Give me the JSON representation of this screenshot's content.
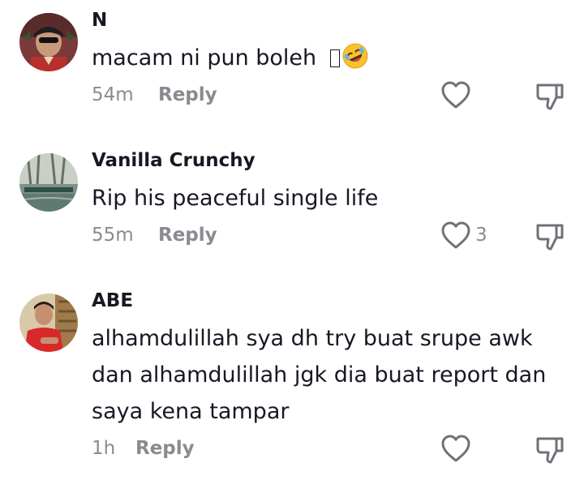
{
  "comments": [
    {
      "username": "N",
      "text": "macam ni pun boleh ",
      "emoji": "rolling-on-floor-laughing",
      "time": "54m",
      "reply_label": "Reply",
      "like_count": ""
    },
    {
      "username": "Vanilla Crunchy",
      "text": "Rip his peaceful single life",
      "time": "55m",
      "reply_label": "Reply",
      "like_count": "3"
    },
    {
      "username": "ABE",
      "text": "alhamdulillah sya dh try buat srupe awk dan alhamdulillah jgk dia buat report dan saya kena tampar",
      "time": "1h",
      "reply_label": "Reply",
      "like_count": ""
    }
  ],
  "icons": {
    "like": "heart-outline-icon",
    "dislike": "thumbs-down-outline-icon"
  },
  "colors": {
    "text": "#161823",
    "secondary": "#8a8b91"
  }
}
